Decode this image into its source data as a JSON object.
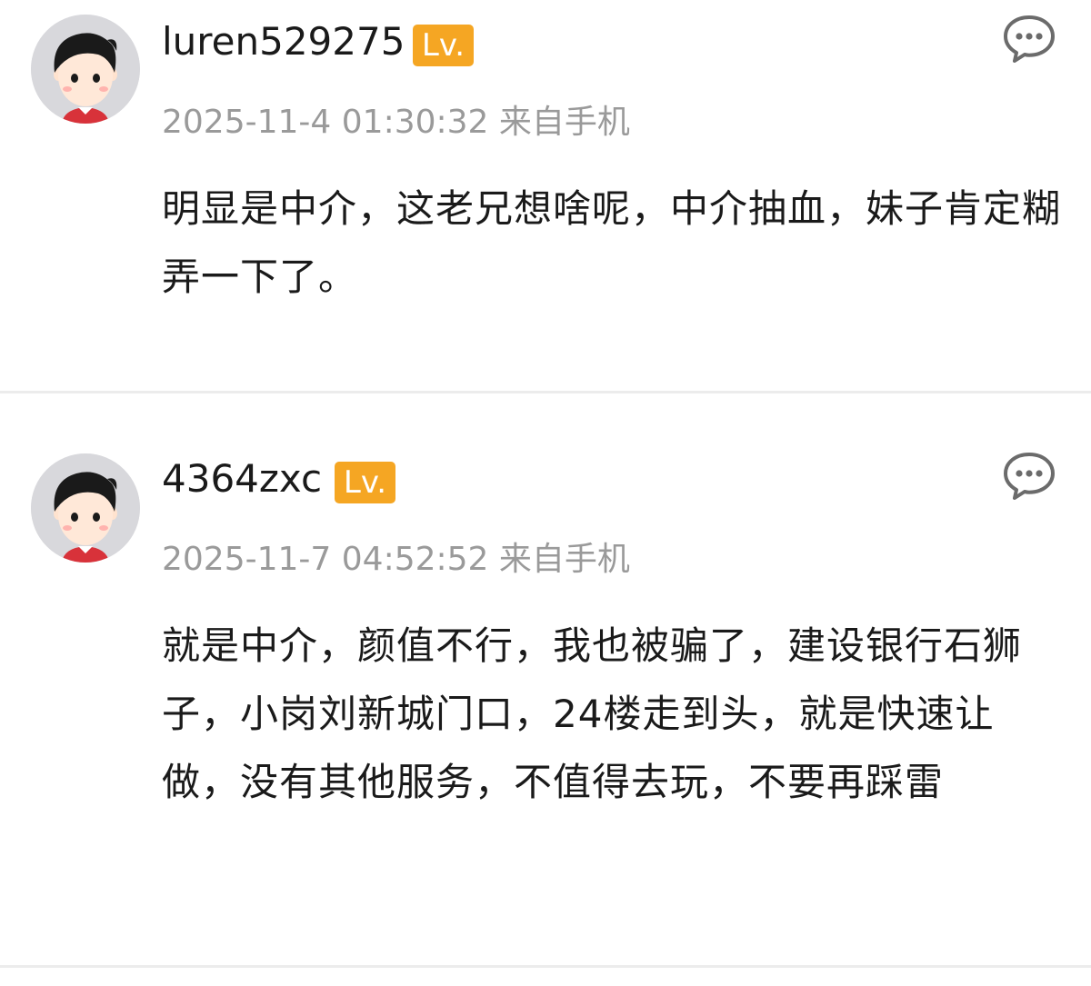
{
  "comments": [
    {
      "avatar_icon": "cartoon-avatar-icon",
      "username": "luren529275",
      "level_label": "Lv.",
      "timestamp": "2025-11-4 01:30:32",
      "source": "来自手机",
      "reply_icon": "comment-bubble-icon",
      "text": "明显是中介，这老兄想啥呢，中介抽血，妹子肯定糊弄一下了。"
    },
    {
      "avatar_icon": "cartoon-avatar-icon",
      "username": "4364zxc",
      "level_label": "Lv.",
      "timestamp": "2025-11-7 04:52:52",
      "source": "来自手机",
      "reply_icon": "comment-bubble-icon",
      "text": "就是中介，颜值不行，我也被骗了，建设银行石狮子，小岗刘新城门口，24楼走到头，就是快速让做，没有其他服务，不值得去玩，不要再踩雷"
    }
  ],
  "colors": {
    "level_badge": "#f5a623",
    "meta_text": "#9a9a9a",
    "body_text": "#1a1a1a",
    "divider": "#ececec",
    "avatar_bg": "#d8d8dc"
  }
}
